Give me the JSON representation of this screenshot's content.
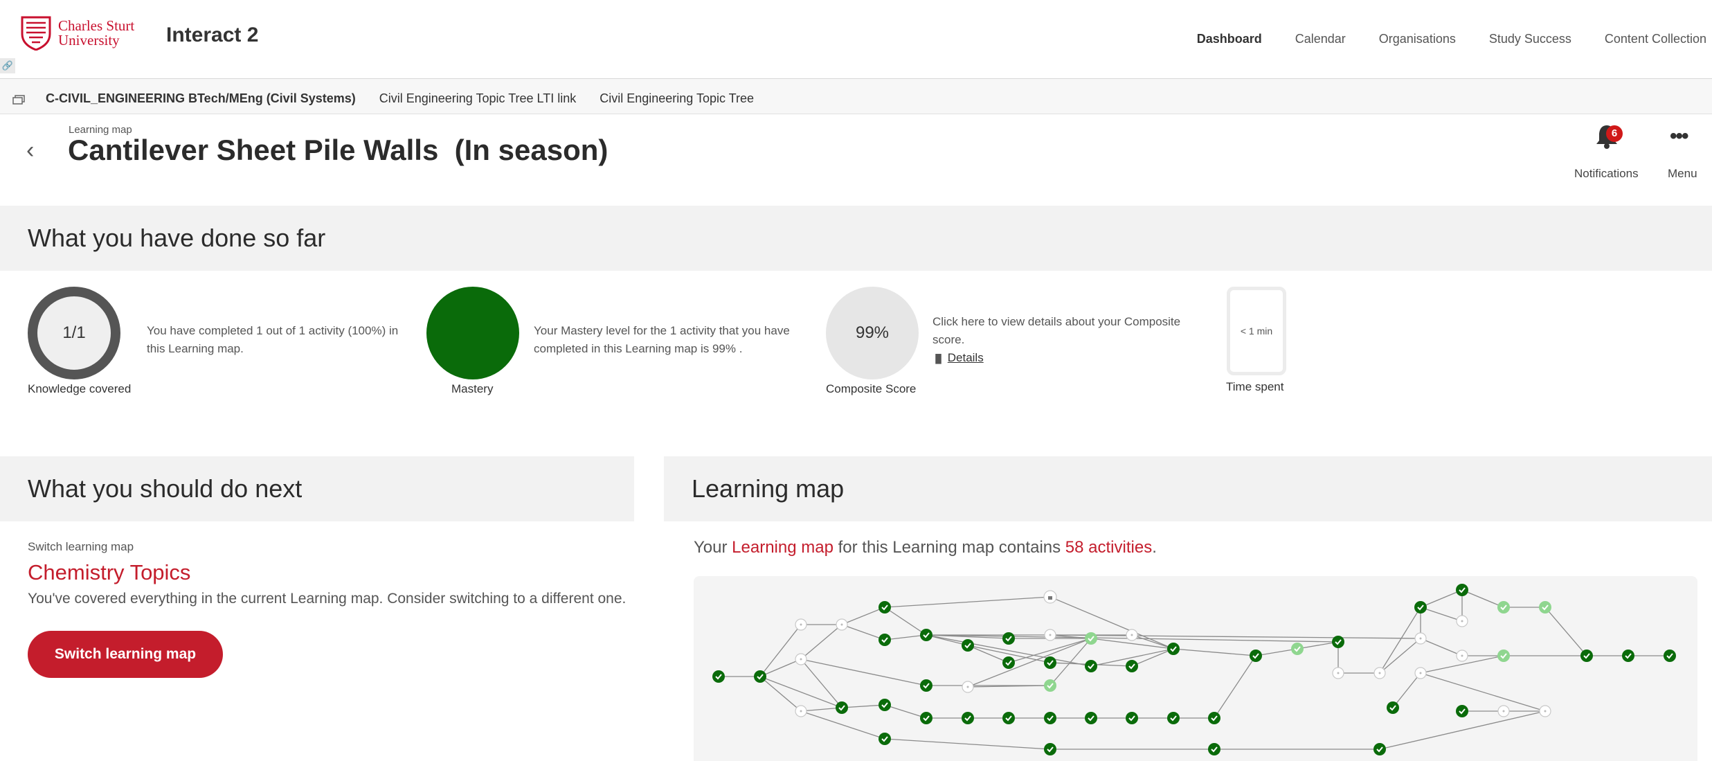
{
  "brand": {
    "logo_text": "Charles Sturt\nUniversity",
    "product": "Interact 2"
  },
  "topnav": [
    "Dashboard",
    "Calendar",
    "Organisations",
    "Study Success",
    "Content Collection"
  ],
  "coursebar": {
    "items": [
      "C-CIVIL_ENGINEERING BTech/MEng (Civil Systems)",
      "Civil Engineering Topic Tree LTI link",
      "Civil Engineering Topic Tree"
    ]
  },
  "page": {
    "subtitle": "Learning map",
    "title": "Cantilever Sheet Pile Walls  (In season)",
    "notifications_label": "Notifications",
    "notifications_count": "6",
    "menu_label": "Menu",
    "menu_glyph": "•••",
    "back_glyph": "‹"
  },
  "done": {
    "heading": "What you have done so far",
    "knowledge": {
      "value": "1/1",
      "caption": "Knowledge covered",
      "text": "You have completed 1 out of 1 activity (100%) in this Learning map."
    },
    "mastery": {
      "caption": "Mastery",
      "text": "Your Mastery level for the 1 activity that you have completed in this Learning map is 99% .",
      "color": "#0a6b0a"
    },
    "composite": {
      "value": "99%",
      "caption": "Composite Score",
      "text": "Click here to view details about your Composite score.",
      "link": "Details"
    },
    "time": {
      "value": "< 1 min",
      "caption": "Time spent"
    }
  },
  "next": {
    "heading": "What you should do next",
    "label": "Switch learning map",
    "suggestion": "Chemistry Topics",
    "message": "You've covered everything in the current Learning map. Consider switching to a different one.",
    "button": "Switch learning map"
  },
  "learning_map": {
    "heading": "Learning map",
    "text_prefix": "Your ",
    "text_link": "Learning map",
    "text_middle": " for this Learning map contains ",
    "text_count": "58 activities",
    "text_suffix": "."
  },
  "colors": {
    "accent": "#c41d2c",
    "done": "#0a6b0a",
    "partial": "#8fd68f"
  }
}
